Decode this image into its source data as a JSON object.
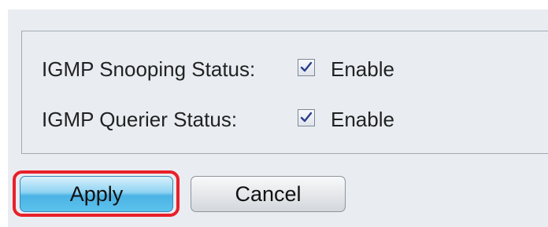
{
  "settings": {
    "rows": [
      {
        "label": "IGMP Snooping Status:",
        "checked": true,
        "option_label": "Enable"
      },
      {
        "label": "IGMP Querier Status:",
        "checked": true,
        "option_label": "Enable"
      }
    ]
  },
  "actions": {
    "apply_label": "Apply",
    "cancel_label": "Cancel"
  },
  "colors": {
    "highlight": "#e8202a",
    "apply_button": "#4bb3e4"
  }
}
